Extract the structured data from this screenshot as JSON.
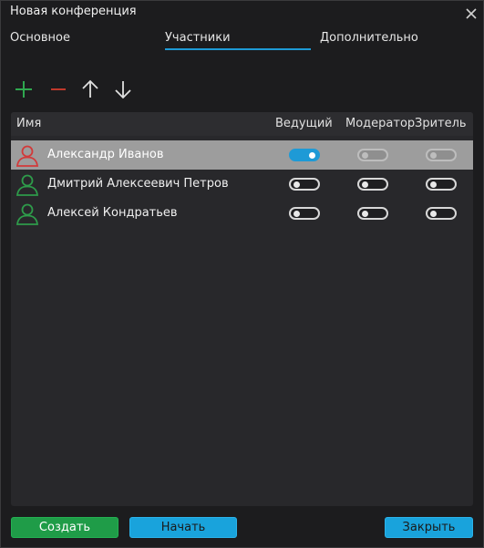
{
  "window": {
    "title": "Новая конференция"
  },
  "tabs": [
    {
      "label": "Основное",
      "active": false
    },
    {
      "label": "Участники",
      "active": true
    },
    {
      "label": "Дополнительно",
      "active": false
    }
  ],
  "table": {
    "headers": {
      "name": "Имя",
      "host": "Ведущий",
      "moderator": "Модератор",
      "viewer": "Зритель"
    },
    "rows": [
      {
        "name": "Александр Иванов",
        "avatar_color": "#d23a3a",
        "host": "on",
        "moderator": "disabled",
        "viewer": "disabled",
        "selected": true
      },
      {
        "name": "Дмитрий Алексеевич Петров",
        "avatar_color": "#2e9b4a",
        "host": "off",
        "moderator": "off",
        "viewer": "off",
        "selected": false
      },
      {
        "name": "Алексей Кондратьев",
        "avatar_color": "#2e9b4a",
        "host": "off",
        "moderator": "off",
        "viewer": "off",
        "selected": false
      }
    ]
  },
  "buttons": {
    "create": "Создать",
    "start": "Начать",
    "close": "Закрыть"
  },
  "colors": {
    "accent": "#1e9ad6",
    "add": "#2fa84f",
    "remove": "#c0392b",
    "create_button": "#1f9c48"
  }
}
